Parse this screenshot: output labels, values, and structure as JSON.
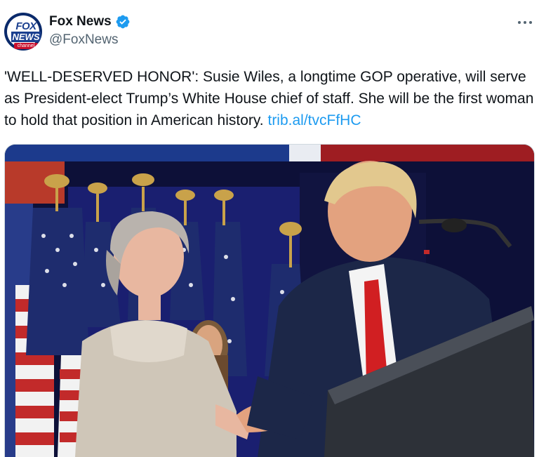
{
  "tweet": {
    "author": {
      "display_name": "Fox News",
      "handle": "@FoxNews",
      "verified": true,
      "avatar_logo": {
        "top": "FOX",
        "middle": "NEWS",
        "bottom": "channel"
      }
    },
    "text_main": "'WELL-DESERVED HONOR': Susie Wiles, a longtime GOP operative, will serve as President-elect Trump’s White House chief of staff. She will be the first woman to hold that position in American history. ",
    "link_text": "trib.al/tvcFfHC",
    "media": {
      "type": "photo"
    }
  },
  "colors": {
    "link": "#1d9bf0",
    "verified": "#1d9bf0",
    "handle": "#536471",
    "text": "#0f1419"
  },
  "icons": {
    "verified": "verified-badge-icon",
    "more": "more-options-icon"
  }
}
